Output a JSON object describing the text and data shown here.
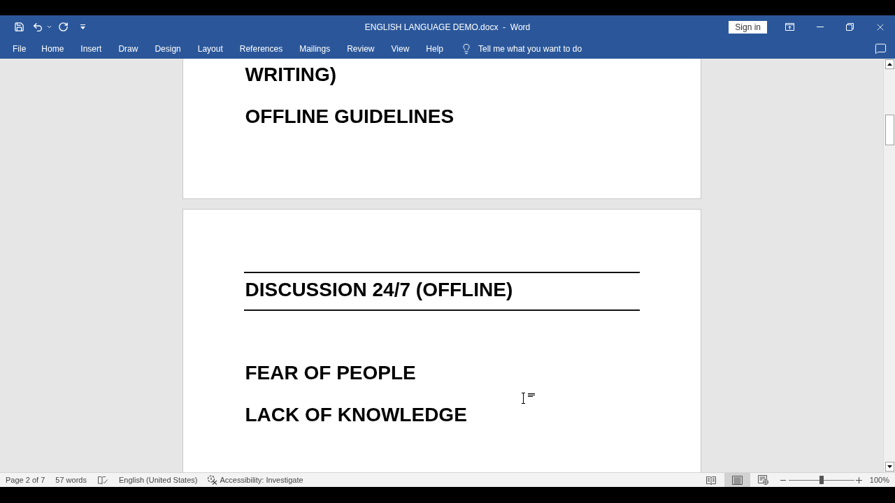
{
  "window": {
    "title": "ENGLISH LANGUAGE DEMO.docx  -  Word",
    "sign_in": "Sign in"
  },
  "ribbon": {
    "tabs": [
      "File",
      "Home",
      "Insert",
      "Draw",
      "Design",
      "Layout",
      "References",
      "Mailings",
      "Review",
      "View",
      "Help"
    ],
    "tell_me": "Tell me what you want to do"
  },
  "document": {
    "pages": [
      {
        "paragraphs": [
          {
            "text": "WRITING)",
            "bordered": false
          },
          {
            "text": "OFFLINE GUIDELINES",
            "bordered": false
          }
        ]
      },
      {
        "paragraphs": [
          {
            "text": "DISCUSSION 24/7 (OFFLINE)",
            "bordered": true
          },
          {
            "text": "FEAR OF PEOPLE",
            "bordered": false
          },
          {
            "text": "LACK OF KNOWLEDGE",
            "bordered": false
          }
        ]
      }
    ]
  },
  "status_bar": {
    "page": "Page 2 of 7",
    "words": "57 words",
    "language": "English (United States)",
    "accessibility": "Accessibility: Investigate",
    "views": [
      {
        "kind": "read",
        "selected": false
      },
      {
        "kind": "print",
        "selected": true
      },
      {
        "kind": "web",
        "selected": false
      }
    ],
    "zoom": {
      "level": 0.5,
      "reading": "100%"
    }
  }
}
